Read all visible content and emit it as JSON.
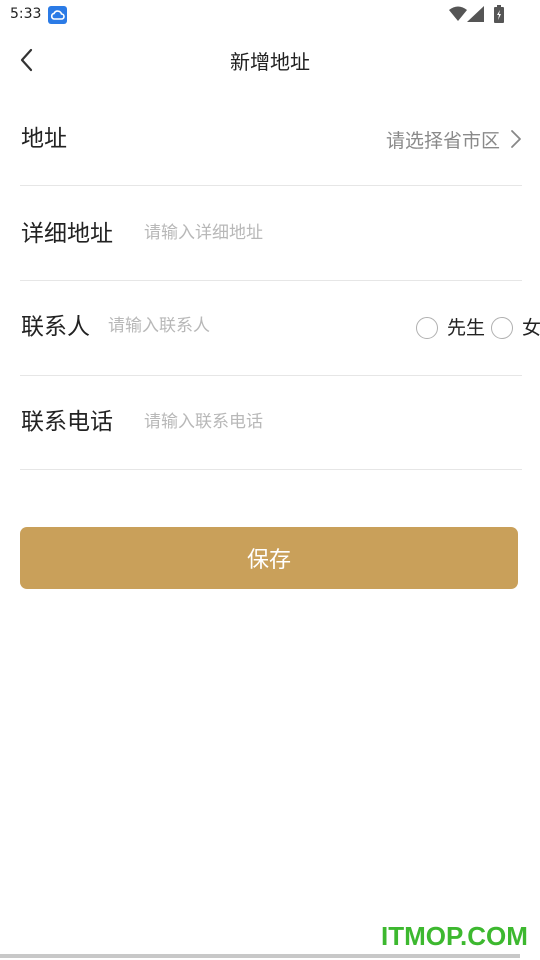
{
  "status_bar": {
    "time": "5:33",
    "app_icon": "cloud-app-icon",
    "icons": [
      "wifi-icon",
      "signal-icon",
      "battery-charging-icon"
    ]
  },
  "nav": {
    "back_icon": "chevron-left-icon",
    "title": "新增地址"
  },
  "form": {
    "address": {
      "label": "地址",
      "placeholder": "请选择省市区",
      "icon": "chevron-right-icon"
    },
    "detail": {
      "label": "详细地址",
      "placeholder": "请输入详细地址"
    },
    "contact": {
      "label": "联系人",
      "placeholder": "请输入联系人",
      "gender_options": [
        {
          "label": "先生",
          "selected": false
        },
        {
          "label": "女",
          "selected": false
        }
      ]
    },
    "phone": {
      "label": "联系电话",
      "placeholder": "请输入联系电话"
    }
  },
  "save_button": {
    "label": "保存",
    "color": "#c9a05a"
  },
  "watermark": {
    "text": "ITMOP.COM",
    "color": "#3db82f"
  }
}
